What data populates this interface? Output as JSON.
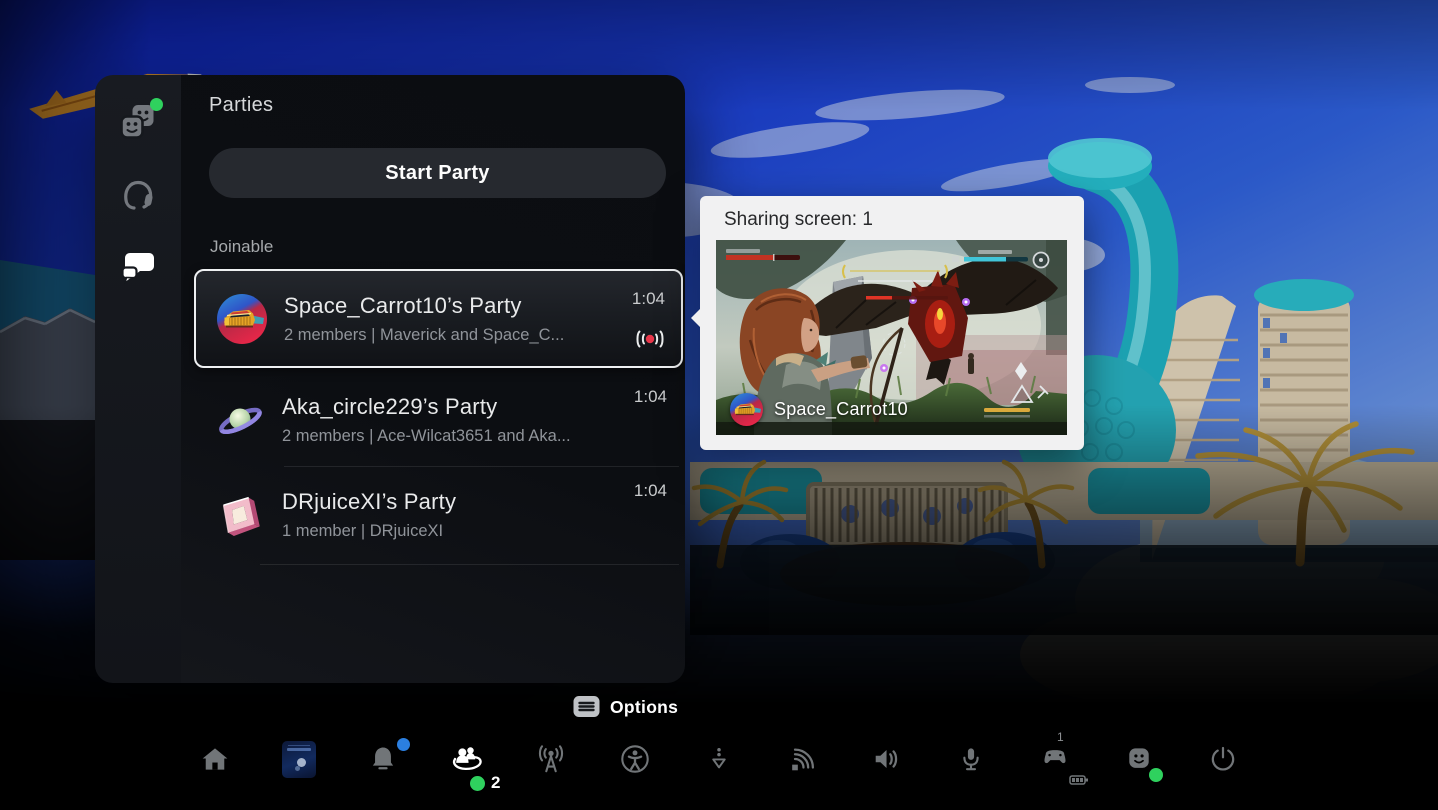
{
  "gamebase_panel": {
    "title": "Parties",
    "start_party_button": "Start Party",
    "section_header": "Joinable",
    "sidebar_tabs": [
      {
        "label": "friends",
        "icon": "friends-icon",
        "active": false,
        "online_badge": true
      },
      {
        "label": "voice-chat",
        "icon": "headset-icon",
        "active": false,
        "online_badge": false
      },
      {
        "label": "messages",
        "icon": "chat-bubbles-icon",
        "active": true,
        "online_badge": false
      }
    ],
    "parties": [
      {
        "name": "Space_Carrot10’s Party",
        "details": "2 members | Maverick and Space_C...",
        "duration": "1:04",
        "selected": true,
        "live_broadcast": true,
        "avatar": "car-avatar"
      },
      {
        "name": "Aka_circle229’s Party",
        "details": "2 members | Ace-Wilcat3651 and Aka...",
        "duration": "1:04",
        "selected": false,
        "live_broadcast": false,
        "avatar": "planet-avatar"
      },
      {
        "name": "DRjuiceXI’s Party",
        "details": "1 member | DRjuiceXI",
        "duration": "1:04",
        "selected": false,
        "live_broadcast": false,
        "avatar": "frame-avatar"
      }
    ]
  },
  "share_popup": {
    "title": "Sharing screen: 1",
    "sharer_name": "Space_Carrot10"
  },
  "options_hint": {
    "label": "Options",
    "icon": "options-button-icon"
  },
  "control_bar": {
    "game_base_count": "2",
    "controller_number": "1",
    "items": [
      {
        "icon": "home-icon"
      },
      {
        "icon": "game-card-thumbnail"
      },
      {
        "icon": "notifications-icon",
        "badge": "blue-dot"
      },
      {
        "icon": "game-base-icon",
        "active": true,
        "badge": "green-dot"
      },
      {
        "icon": "broadcast-icon"
      },
      {
        "icon": "accessibility-icon"
      },
      {
        "icon": "downloads-icon"
      },
      {
        "icon": "network-icon"
      },
      {
        "icon": "sound-icon"
      },
      {
        "icon": "mic-icon"
      },
      {
        "icon": "controller-icon"
      },
      {
        "icon": "profile-icon",
        "badge": "green-dot"
      },
      {
        "icon": "power-icon"
      }
    ]
  },
  "colors": {
    "online_green": "#2fd15e",
    "notification_blue": "#2b7fe0",
    "live_red": "#e8364a",
    "panel_bg": "#0d1014",
    "popup_bg": "#f1f1f2"
  }
}
